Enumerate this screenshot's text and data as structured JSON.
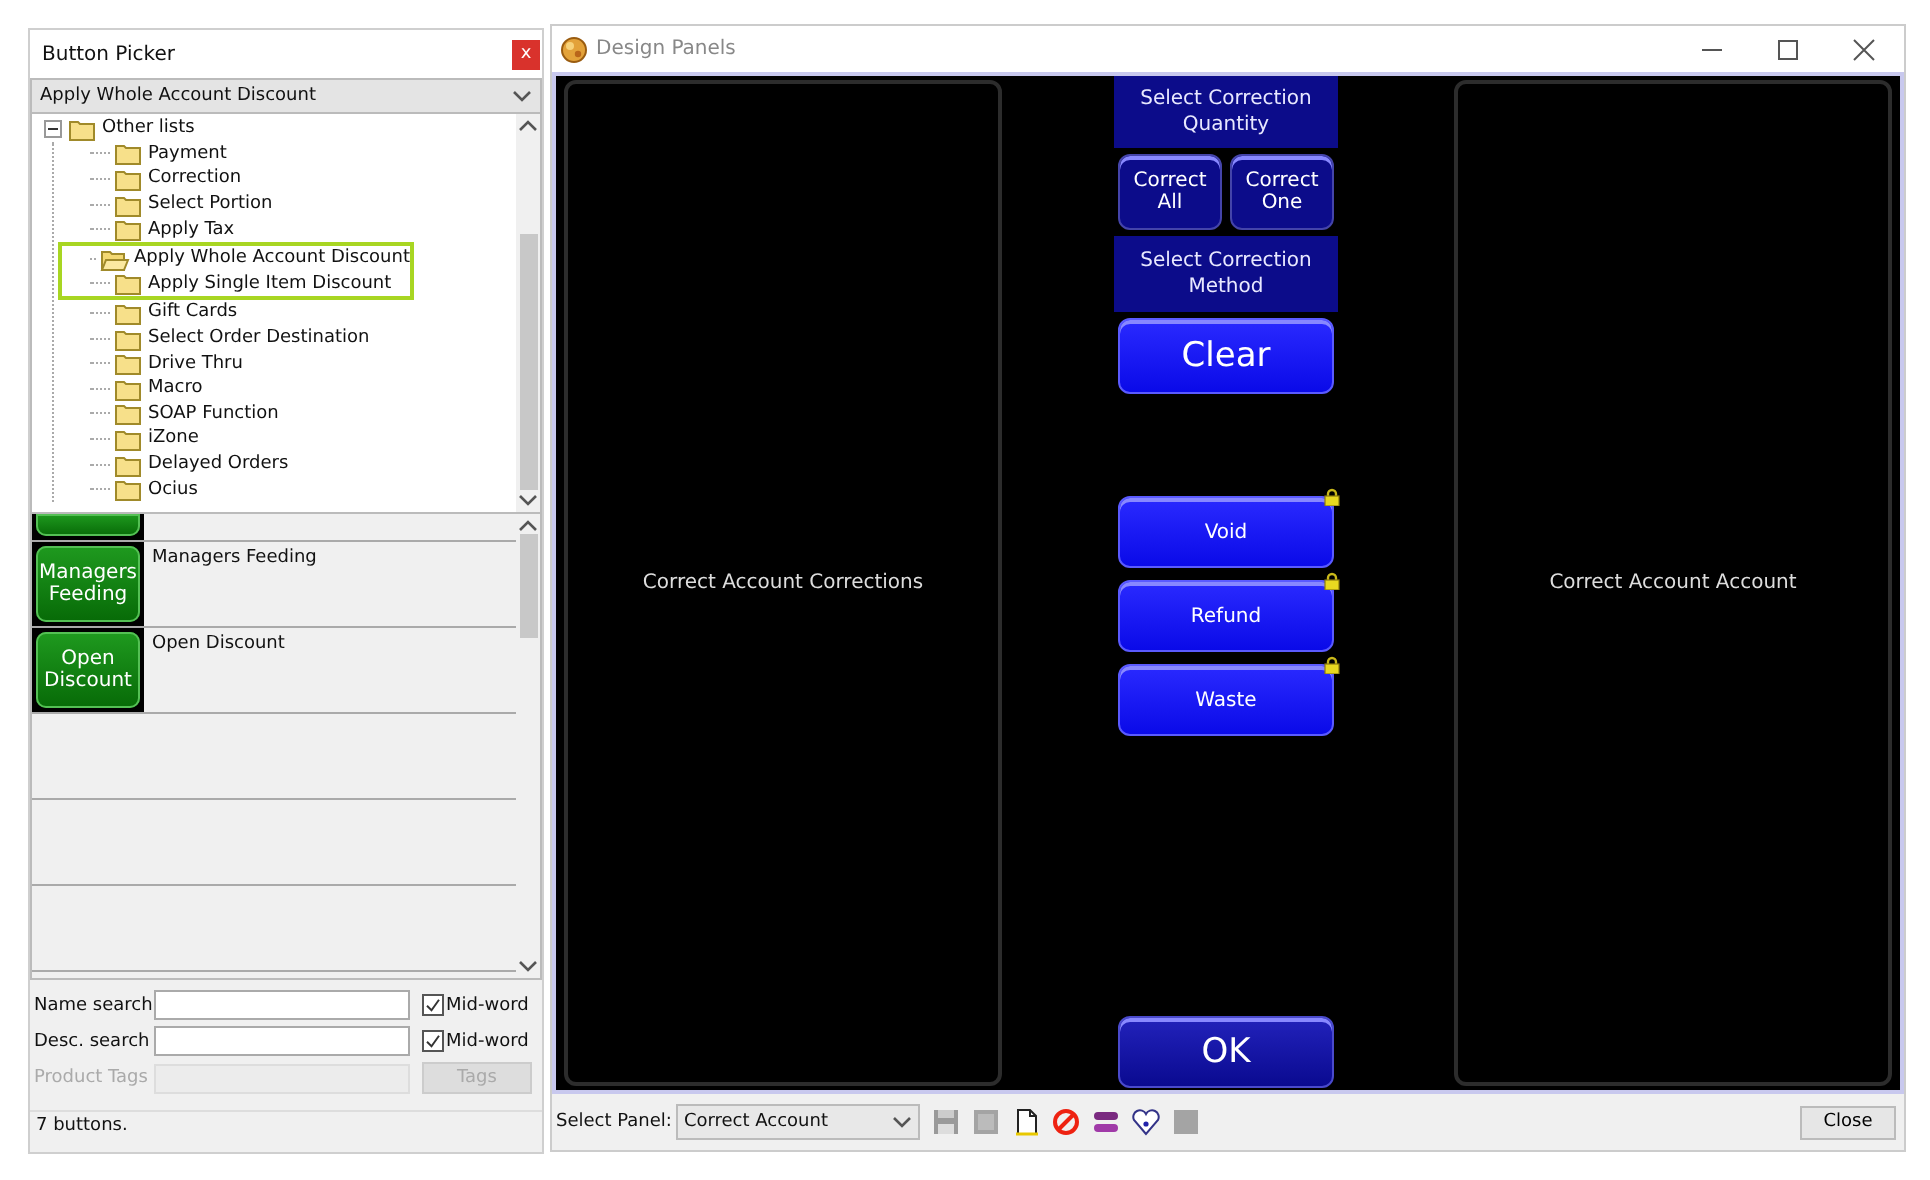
{
  "picker": {
    "title": "Button Picker",
    "close": "x",
    "category": "Apply Whole Account Discount",
    "tree": {
      "label": "Other lists",
      "expanded": true,
      "children": [
        {
          "label": "Payment",
          "highlighted": false
        },
        {
          "label": "Correction",
          "highlighted": false
        },
        {
          "label": "Select Portion",
          "highlighted": false
        },
        {
          "label": "Apply Tax",
          "highlighted": false
        },
        {
          "label": "Apply Whole Account Discount",
          "highlighted": true
        },
        {
          "label": "Apply Single Item Discount",
          "highlighted": true
        },
        {
          "label": "Gift Cards",
          "highlighted": false
        },
        {
          "label": "Select Order Destination",
          "highlighted": false
        },
        {
          "label": "Drive Thru",
          "highlighted": false
        },
        {
          "label": "Macro",
          "highlighted": false
        },
        {
          "label": "SOAP Function",
          "highlighted": false
        },
        {
          "label": "iZone",
          "highlighted": false
        },
        {
          "label": "Delayed Orders",
          "highlighted": false
        },
        {
          "label": "Ocius",
          "highlighted": false
        }
      ]
    },
    "buttons": [
      {
        "label": "Managers Feeding",
        "description": "Managers Feeding"
      },
      {
        "label": "Open Discount",
        "description": "Open Discount"
      }
    ],
    "name_search": {
      "label": "Name search",
      "mid_word_label": "Mid-word",
      "mid_word": true
    },
    "desc_search": {
      "label": "Desc. search",
      "mid_word_label": "Mid-word",
      "mid_word": true
    },
    "product_tags": {
      "label": "Product Tags",
      "disabled": true,
      "button": "Tags"
    },
    "status": "7 buttons."
  },
  "designer": {
    "title": "Design Panels",
    "left_panel": "Correct Account Corrections",
    "right_panel": "Correct Account Account",
    "center": [
      {
        "kind": "label",
        "text": "Select Correction Quantity"
      },
      {
        "kind": "pair",
        "buttons": [
          "Correct All",
          "Correct One"
        ]
      },
      {
        "kind": "label",
        "text": "Select Correction Method"
      },
      {
        "kind": "large",
        "text": "Clear"
      },
      {
        "kind": "gap"
      },
      {
        "kind": "button",
        "text": "Void",
        "locked": true
      },
      {
        "kind": "button",
        "text": "Refund",
        "locked": true
      },
      {
        "kind": "button",
        "text": "Waste",
        "locked": true
      }
    ],
    "ok": "OK",
    "select_panel": {
      "label": "Select Panel:",
      "value": "Correct Account"
    },
    "close": "Close"
  }
}
